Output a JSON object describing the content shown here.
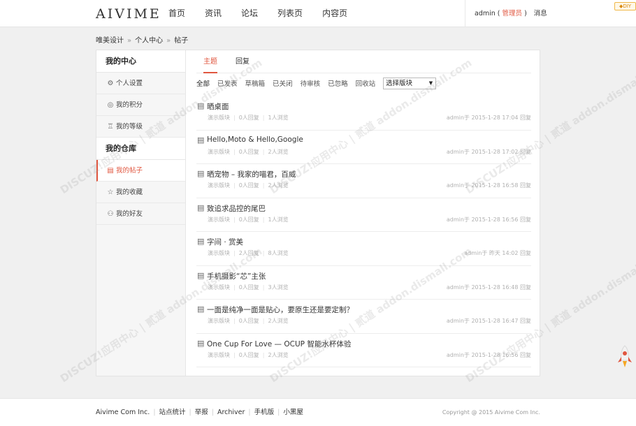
{
  "header": {
    "logo": "AIVIME",
    "nav": [
      "首页",
      "资讯",
      "论坛",
      "列表页",
      "内容页"
    ],
    "user": "admin",
    "role_open": " (",
    "role": " 管理员 ",
    "role_close": ")",
    "message": "消息",
    "diy": "◆DIY"
  },
  "breadcrumb": [
    "唯美设计",
    "个人中心",
    "帖子"
  ],
  "breadcrumb_sep": "»",
  "sidebar": {
    "center_title": "我的中心",
    "center_items": [
      {
        "label": "个人设置",
        "icon": "gear-icon"
      },
      {
        "label": "我的积分",
        "icon": "coins-icon"
      },
      {
        "label": "我的等级",
        "icon": "trophy-icon"
      }
    ],
    "warehouse_title": "我的仓库",
    "warehouse_items": [
      {
        "label": "我的帖子",
        "icon": "document-icon",
        "active": true
      },
      {
        "label": "我的收藏",
        "icon": "star-icon"
      },
      {
        "label": "我的好友",
        "icon": "friends-icon"
      }
    ]
  },
  "tabs": [
    "主题",
    "回复"
  ],
  "filters": [
    "全部",
    "已发表",
    "草稿箱",
    "已关闭",
    "待审核",
    "已忽略",
    "回收站"
  ],
  "select_label": "选择版块",
  "threads": [
    {
      "title": "晒桌面",
      "forum": "演示版块",
      "replies": "0人回复",
      "views": "1人浏览",
      "right": "admin于 2015-1-28 17:04 回复"
    },
    {
      "title": "Hello,Moto & Hello,Google",
      "forum": "演示版块",
      "replies": "0人回复",
      "views": "2人浏览",
      "right": "admin于 2015-1-28 17:02 回复"
    },
    {
      "title": "晒宠物 – 我家的喵君，百威",
      "forum": "演示版块",
      "replies": "0人回复",
      "views": "2人浏览",
      "right": "admin于 2015-1-28 16:58 回复"
    },
    {
      "title": "致追求品控的尾巴",
      "forum": "演示版块",
      "replies": "0人回复",
      "views": "1人浏览",
      "right": "admin于 2015-1-28 16:56 回复"
    },
    {
      "title": "字间 · 赏美",
      "forum": "演示版块",
      "replies": "2人回复",
      "views": "8人浏览",
      "right": "admin于 昨天 14:02 回复"
    },
    {
      "title": "手机摄影“芯”主张",
      "forum": "演示版块",
      "replies": "0人回复",
      "views": "3人浏览",
      "right": "admin于 2015-1-28 16:48 回复"
    },
    {
      "title": "一面是纯净一面是贴心，要原生还是要定制？",
      "forum": "演示版块",
      "replies": "0人回复",
      "views": "2人浏览",
      "right": "admin于 2015-1-28 16:47 回复"
    },
    {
      "title": "One Cup For Love — OCUP 智能水杯体验",
      "forum": "演示版块",
      "replies": "0人回复",
      "views": "2人浏览",
      "right": "admin于 2015-1-28 16:56 回复"
    }
  ],
  "footer": {
    "links": [
      "Aivime Com Inc.",
      "站点统计",
      "举报",
      "Archiver",
      "手机版",
      "小黑屋"
    ],
    "copyright": "Copyright @ 2015 Aivime Com Inc."
  },
  "watermark": "DISCUZ!应用中心 | 贰道 addon.dismall.com",
  "colors": {
    "accent": "#e0563f",
    "background": "#f0f0f0"
  }
}
